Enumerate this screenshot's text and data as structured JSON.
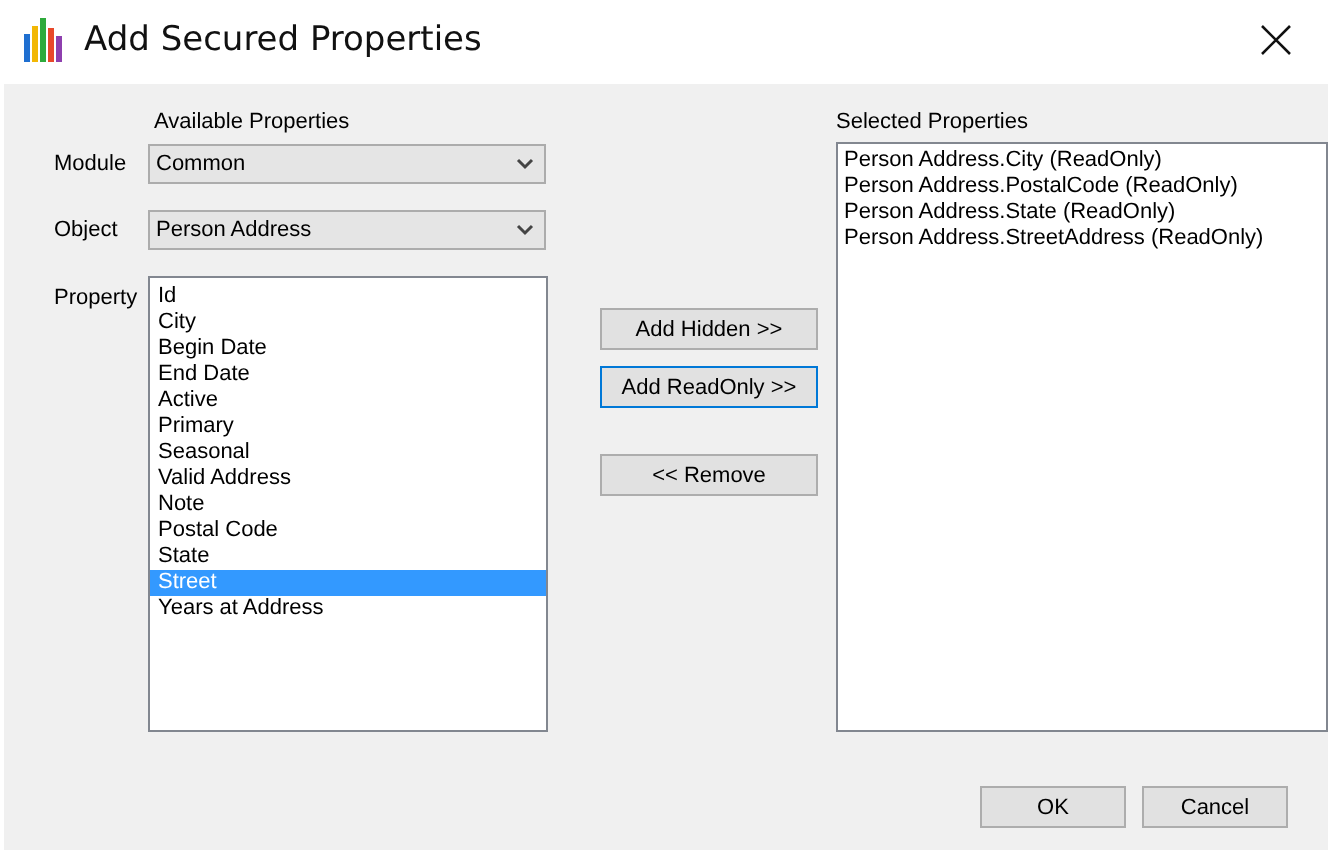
{
  "window": {
    "title": "Add Secured Properties"
  },
  "available": {
    "heading": "Available Properties",
    "module": {
      "label": "Module",
      "value": "Common"
    },
    "object": {
      "label": "Object",
      "value": "Person Address"
    },
    "property": {
      "label": "Property",
      "items": [
        {
          "text": "Id",
          "selected": false
        },
        {
          "text": "City",
          "selected": false
        },
        {
          "text": "Begin Date",
          "selected": false
        },
        {
          "text": "End Date",
          "selected": false
        },
        {
          "text": "Active",
          "selected": false
        },
        {
          "text": "Primary",
          "selected": false
        },
        {
          "text": "Seasonal",
          "selected": false
        },
        {
          "text": "Valid Address",
          "selected": false
        },
        {
          "text": "Note",
          "selected": false
        },
        {
          "text": "Postal Code",
          "selected": false
        },
        {
          "text": "State",
          "selected": false
        },
        {
          "text": "Street",
          "selected": true
        },
        {
          "text": "Years at Address",
          "selected": false
        }
      ]
    }
  },
  "actions": [
    {
      "label": "Add Hidden >>",
      "focused": false
    },
    {
      "label": "Add ReadOnly >>",
      "focused": true
    },
    {
      "label": "<< Remove",
      "focused": false
    }
  ],
  "selected": {
    "heading": "Selected Properties",
    "items": [
      "Person Address.City (ReadOnly)",
      "Person Address.PostalCode (ReadOnly)",
      "Person Address.State (ReadOnly)",
      "Person Address.StreetAddress (ReadOnly)"
    ]
  },
  "buttons": [
    "OK",
    "Cancel"
  ]
}
